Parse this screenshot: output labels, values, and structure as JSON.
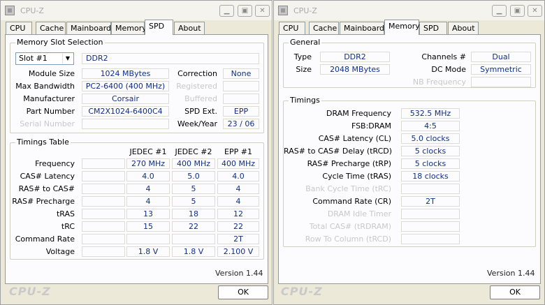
{
  "left": {
    "title": "CPU-Z",
    "tabs": [
      "CPU",
      "Cache",
      "Mainboard",
      "Memory",
      "SPD",
      "About"
    ],
    "active_tab": "SPD",
    "slot_group_title": "Memory Slot Selection",
    "slot_selected": "Slot #1",
    "memory_type": "DDR2",
    "module_size_label": "Module Size",
    "module_size": "1024 MBytes",
    "max_bandwidth_label": "Max Bandwidth",
    "max_bandwidth": "PC2-6400 (400 MHz)",
    "manufacturer_label": "Manufacturer",
    "manufacturer": "Corsair",
    "part_number_label": "Part Number",
    "part_number": "CM2X1024-6400C4",
    "serial_number_label": "Serial Number",
    "serial_number": "",
    "correction_label": "Correction",
    "correction": "None",
    "registered_label": "Registered",
    "registered": "",
    "buffered_label": "Buffered",
    "buffered": "",
    "spd_ext_label": "SPD Ext.",
    "spd_ext": "EPP",
    "week_year_label": "Week/Year",
    "week_year": "23 / 06",
    "timings_group_title": "Timings Table",
    "columns": [
      "JEDEC #1",
      "JEDEC #2",
      "EPP #1"
    ],
    "rows": [
      {
        "label": "Frequency",
        "values": [
          "270 MHz",
          "400 MHz",
          "400 MHz"
        ]
      },
      {
        "label": "CAS# Latency",
        "values": [
          "4.0",
          "5.0",
          "4.0"
        ]
      },
      {
        "label": "RAS# to CAS#",
        "values": [
          "4",
          "5",
          "4"
        ]
      },
      {
        "label": "RAS# Precharge",
        "values": [
          "4",
          "5",
          "4"
        ]
      },
      {
        "label": "tRAS",
        "values": [
          "13",
          "18",
          "12"
        ]
      },
      {
        "label": "tRC",
        "values": [
          "15",
          "22",
          "22"
        ]
      },
      {
        "label": "Command Rate",
        "values": [
          "",
          "",
          "2T"
        ]
      },
      {
        "label": "Voltage",
        "values": [
          "1.8 V",
          "1.8 V",
          "2.100 V"
        ]
      }
    ],
    "version": "Version 1.44",
    "logo": "CPU-Z",
    "ok": "OK"
  },
  "right": {
    "title": "CPU-Z",
    "tabs": [
      "CPU",
      "Cache",
      "Mainboard",
      "Memory",
      "SPD",
      "About"
    ],
    "active_tab": "Memory",
    "general_group_title": "General",
    "type_label": "Type",
    "type": "DDR2",
    "size_label": "Size",
    "size": "2048 MBytes",
    "channels_label": "Channels #",
    "channels": "Dual",
    "dc_mode_label": "DC Mode",
    "dc_mode": "Symmetric",
    "nb_freq_label": "NB Frequency",
    "nb_freq": "",
    "timings_group_title": "Timings",
    "timings": [
      {
        "label": "DRAM Frequency",
        "value": "532.5 MHz",
        "enabled": true
      },
      {
        "label": "FSB:DRAM",
        "value": "4:5",
        "enabled": true
      },
      {
        "label": "CAS# Latency (CL)",
        "value": "5.0 clocks",
        "enabled": true
      },
      {
        "label": "RAS# to CAS# Delay (tRCD)",
        "value": "5 clocks",
        "enabled": true
      },
      {
        "label": "RAS# Precharge (tRP)",
        "value": "5 clocks",
        "enabled": true
      },
      {
        "label": "Cycle Time (tRAS)",
        "value": "18 clocks",
        "enabled": true
      },
      {
        "label": "Bank Cycle Time (tRC)",
        "value": "",
        "enabled": false
      },
      {
        "label": "Command Rate (CR)",
        "value": "2T",
        "enabled": true
      },
      {
        "label": "DRAM Idle Timer",
        "value": "",
        "enabled": false
      },
      {
        "label": "Total CAS# (tRDRAM)",
        "value": "",
        "enabled": false
      },
      {
        "label": "Row To Column (tRCD)",
        "value": "",
        "enabled": false
      }
    ],
    "version": "Version 1.44",
    "logo": "CPU-Z",
    "ok": "OK"
  },
  "icons": {
    "minimize": "minimize-icon",
    "maximize": "maximize-icon",
    "close": "close-icon",
    "dropdown": "chevron-down-icon"
  },
  "colors": {
    "value_text": "#0f2f86",
    "window_bg": "#ece9d8",
    "panel_bg": "#fcfcfe",
    "disabled_text": "#c8c8c8"
  }
}
